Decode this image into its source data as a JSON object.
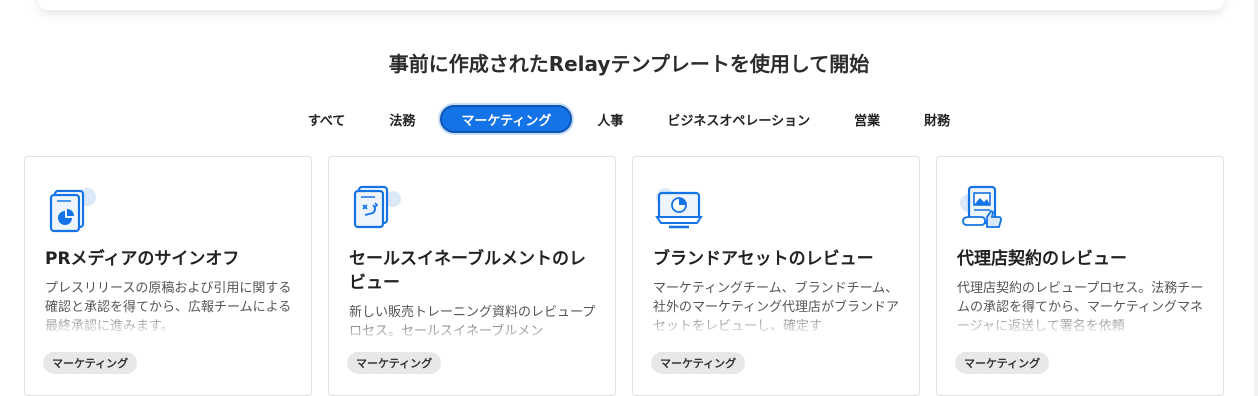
{
  "heading": "事前に作成されたRelayテンプレートを使用して開始",
  "tabs": [
    {
      "label": "すべて"
    },
    {
      "label": "法務"
    },
    {
      "label": "マーケティング",
      "active": true
    },
    {
      "label": "人事"
    },
    {
      "label": "ビジネスオペレーション"
    },
    {
      "label": "営業"
    },
    {
      "label": "財務"
    }
  ],
  "cards": [
    {
      "title": "PRメディアのサインオフ",
      "description": "プレスリリースの原稿および引用に関する確認と承認を得てから、広報チームによる最終承認に進みます。",
      "tag": "マーケティング",
      "icon": "document-pie-chart-icon"
    },
    {
      "title": "セールスイネーブルメントのレビュー",
      "description": "新しい販売トレーニング資料のレビュープロセス。セールスイネーブルメン",
      "tag": "マーケティング",
      "icon": "document-workflow-icon"
    },
    {
      "title": "ブランドアセットのレビュー",
      "description": "マーケティングチーム、ブランドチーム、社外のマーケティング代理店がブランドアセットをレビューし、確定す",
      "tag": "マーケティング",
      "icon": "monitor-chart-icon"
    },
    {
      "title": "代理店契約のレビュー",
      "description": "代理店契約のレビュープロセス。法務チームの承認を得てから、マーケティングマネージャに返送して署名を依頼",
      "tag": "マーケティング",
      "icon": "document-image-approval-icon"
    }
  ],
  "colors": {
    "accent": "#1473e6",
    "icon_blue": "#1473e6",
    "icon_light": "#dbe8f8"
  }
}
